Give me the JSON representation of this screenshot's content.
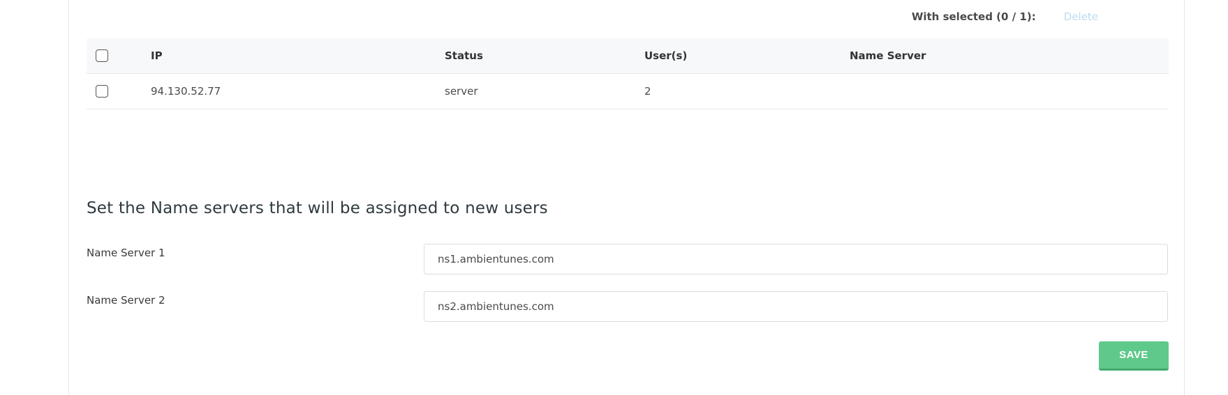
{
  "toolbar": {
    "selected_label": "With selected (0 / 1):",
    "delete_label": "Delete"
  },
  "table": {
    "columns": [
      "IP",
      "Status",
      "User(s)",
      "Name Server"
    ],
    "rows": [
      {
        "ip": "94.130.52.77",
        "status": "server",
        "users": "2",
        "name_server": ""
      }
    ]
  },
  "nameservers": {
    "title": "Set the Name servers that will be assigned to new users",
    "ns1_label": "Name Server 1",
    "ns1_value": "ns1.ambientunes.com",
    "ns2_label": "Name Server 2",
    "ns2_value": "ns2.ambientunes.com",
    "save_label": "SAVE"
  },
  "colors": {
    "save_button": "#5ec98a",
    "delete_disabled": "#b9dcf2"
  }
}
